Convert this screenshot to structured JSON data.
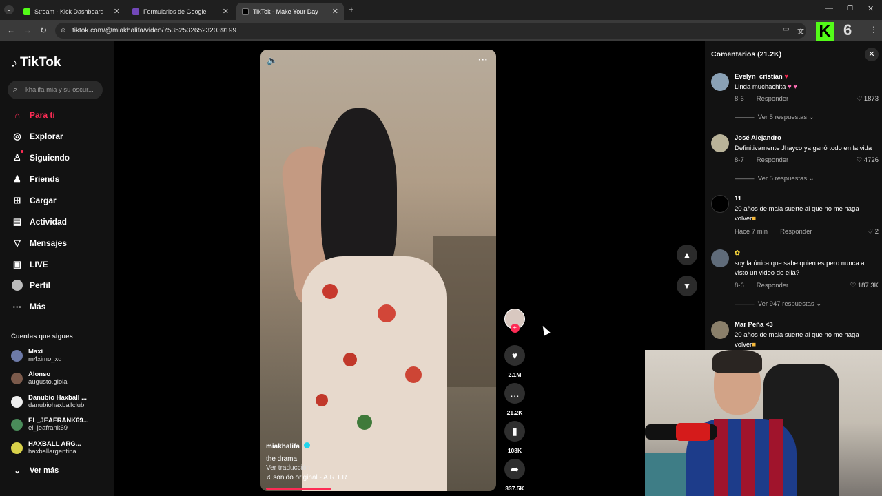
{
  "browser": {
    "tabs": [
      {
        "title": "Stream - Kick Dashboard",
        "favicon_color": "#53fc18"
      },
      {
        "title": "Formularios de Google",
        "favicon_color": "#7248b9"
      },
      {
        "title": "TikTok - Make Your Day",
        "favicon_color": "#000000"
      }
    ],
    "url": "tiktok.com/@miakhalifa/video/7535253265232039199",
    "overlay_number": "6"
  },
  "sidebar": {
    "logo": "TikTok",
    "search_placeholder": "khalifa mia y su oscur...",
    "nav": [
      {
        "label": "Para ti",
        "icon": "home-icon",
        "active": true
      },
      {
        "label": "Explorar",
        "icon": "compass-icon"
      },
      {
        "label": "Siguiendo",
        "icon": "following-icon"
      },
      {
        "label": "Friends",
        "icon": "friends-icon"
      },
      {
        "label": "Cargar",
        "icon": "upload-icon"
      },
      {
        "label": "Actividad",
        "icon": "activity-icon"
      },
      {
        "label": "Mensajes",
        "icon": "messages-icon"
      },
      {
        "label": "LIVE",
        "icon": "live-icon"
      },
      {
        "label": "Perfil",
        "icon": "profile-icon"
      },
      {
        "label": "Más",
        "icon": "more-icon"
      }
    ],
    "following_title": "Cuentas que sigues",
    "accounts": [
      {
        "name": "Maxi",
        "handle": "m4ximo_xd"
      },
      {
        "name": "Alonso",
        "handle": "augusto.gioia"
      },
      {
        "name": "Danubio Haxball ...",
        "handle": "danubiohaxballclub"
      },
      {
        "name": "EL_JEAFRANK69...",
        "handle": "el_jeafrank69"
      },
      {
        "name": "HAXBALL ARG...",
        "handle": "haxballargentina"
      }
    ],
    "see_more": "Ver más"
  },
  "video": {
    "author": "miakhalifa",
    "caption": "the drama",
    "translate": "Ver traducción",
    "sound": "sonido original - A.R.T.R",
    "progress": 0.29
  },
  "actions": {
    "likes": "2.1M",
    "comments": "21.2K",
    "saves": "108K",
    "shares": "337.5K"
  },
  "comments_panel": {
    "title": "Comentarios (21.2K)",
    "reply_label": "Responder",
    "items": [
      {
        "user": "Evelyn_cristian",
        "text": "Linda muchachita",
        "date": "8-6",
        "likes": "1873",
        "replies": "Ver 5 respuestas"
      },
      {
        "user": "José Alejandro",
        "text": "Definitivamente Jhayco ya ganó todo en la vida",
        "date": "8-7",
        "likes": "4726",
        "replies": "Ver 5 respuestas"
      },
      {
        "user": "11",
        "text": "20 años de mala suerte al que no me haga volver",
        "date": "Hace 7 min",
        "likes": "2",
        "replies": ""
      },
      {
        "user": "",
        "text": "soy la única que sabe quien es pero nunca a visto un video de ella?",
        "date": "8-6",
        "likes": "187.3K",
        "replies": "Ver 947 respuestas"
      },
      {
        "user": "Mar Peña <3",
        "text": "20 años de mala suerte al que no me haga volver",
        "date": "",
        "likes": "",
        "replies": ""
      }
    ]
  },
  "colors": {
    "accent": "#fe2c55",
    "kick": "#53fc18"
  }
}
